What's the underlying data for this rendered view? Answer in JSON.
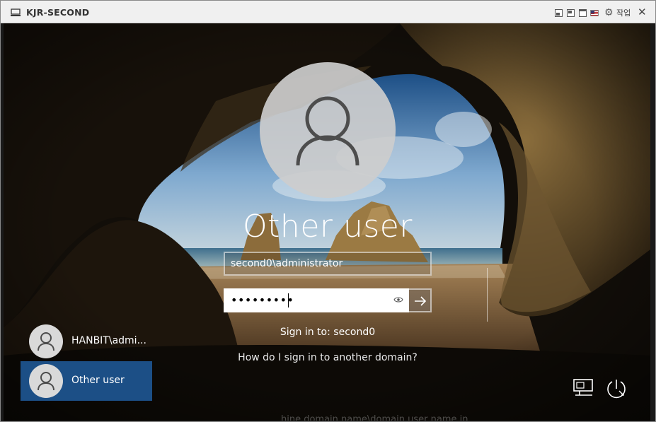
{
  "window": {
    "title": "KJR-SECOND",
    "menu_label": "작업"
  },
  "login": {
    "heading": "Other user",
    "username_value": "second0\\administrator",
    "password_mask": "•••••••••",
    "sign_in_to": "Sign in to: second0",
    "domain_help_link": "How do I sign in to another domain?",
    "partial_bottom_text": "hine domain name\\domain user name in"
  },
  "users": [
    {
      "label": "HANBIT\\admi...",
      "selected": false
    },
    {
      "label": "Other user",
      "selected": true
    }
  ],
  "icons": {
    "vm": "monitor-icon",
    "gear": "gear-icon",
    "close": "close-icon",
    "eye": "eye-icon",
    "arrow": "arrow-right-icon",
    "network": "network-icon",
    "power": "power-icon",
    "avatar": "user-avatar-icon"
  },
  "colors": {
    "selected_tile": "#1c4f86",
    "titlebar_bg": "#f0f0f0"
  }
}
